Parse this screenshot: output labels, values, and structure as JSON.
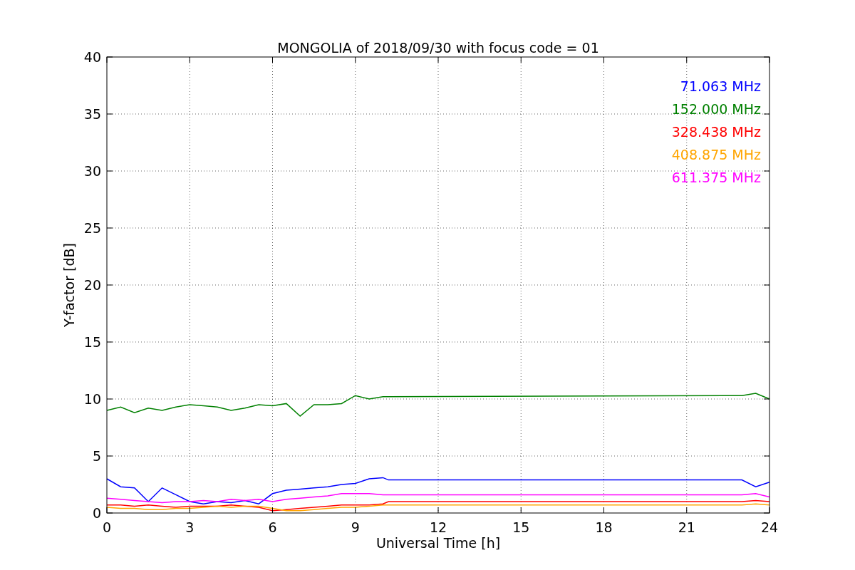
{
  "chart": {
    "chart_data": {
      "type": "line",
      "title": "MONGOLIA of 2018/09/30 with focus code = 01",
      "xlabel": "Universal Time [h]",
      "ylabel": "Y-factor [dB]",
      "x": [
        0,
        0.5,
        1,
        1.5,
        2,
        2.5,
        3,
        3.5,
        4,
        4.5,
        5,
        5.5,
        6,
        6.5,
        7,
        7.5,
        8,
        8.5,
        9,
        9.5,
        10,
        10.2,
        23,
        23.5,
        24
      ],
      "series": [
        {
          "name": "71.063 MHz",
          "color": "#0000ff",
          "values": [
            3.0,
            2.3,
            2.2,
            1.0,
            2.2,
            1.6,
            1.0,
            0.8,
            1.0,
            0.9,
            1.1,
            0.8,
            1.7,
            2.0,
            2.1,
            2.2,
            2.3,
            2.5,
            2.6,
            3.0,
            3.1,
            2.9,
            2.9,
            2.3,
            2.7
          ]
        },
        {
          "name": "152.000 MHz",
          "color": "#008000",
          "values": [
            9.0,
            9.3,
            8.8,
            9.2,
            9.0,
            9.3,
            9.5,
            9.4,
            9.3,
            9.0,
            9.2,
            9.5,
            9.4,
            9.6,
            8.5,
            9.5,
            9.5,
            9.6,
            10.3,
            10.0,
            10.2,
            10.2,
            10.3,
            10.5,
            10.0
          ]
        },
        {
          "name": "328.438 MHz",
          "color": "#ff0000",
          "values": [
            0.7,
            0.7,
            0.6,
            0.7,
            0.6,
            0.5,
            0.6,
            0.6,
            0.6,
            0.7,
            0.6,
            0.5,
            0.2,
            0.3,
            0.4,
            0.5,
            0.6,
            0.7,
            0.7,
            0.7,
            0.8,
            1.0,
            1.0,
            1.1,
            1.0
          ]
        },
        {
          "name": "408.875 MHz",
          "color": "#ffa500",
          "values": [
            0.5,
            0.4,
            0.4,
            0.3,
            0.3,
            0.4,
            0.4,
            0.5,
            0.6,
            0.5,
            0.6,
            0.6,
            0.4,
            0.2,
            0.2,
            0.3,
            0.4,
            0.5,
            0.5,
            0.6,
            0.7,
            0.7,
            0.7,
            0.8,
            0.7
          ]
        },
        {
          "name": "611.375 MHz",
          "color": "#ff00ff",
          "values": [
            1.3,
            1.2,
            1.1,
            1.0,
            0.9,
            1.0,
            1.0,
            1.1,
            1.0,
            1.2,
            1.1,
            1.2,
            1.0,
            1.2,
            1.3,
            1.4,
            1.5,
            1.7,
            1.7,
            1.7,
            1.6,
            1.6,
            1.6,
            1.7,
            1.4
          ]
        }
      ],
      "xlim": [
        0,
        24
      ],
      "ylim": [
        0,
        40
      ],
      "xticks": [
        0,
        3,
        6,
        9,
        12,
        15,
        18,
        21,
        24
      ],
      "yticks": [
        0,
        5,
        10,
        15,
        20,
        25,
        30,
        35,
        40
      ],
      "grid": true
    }
  }
}
